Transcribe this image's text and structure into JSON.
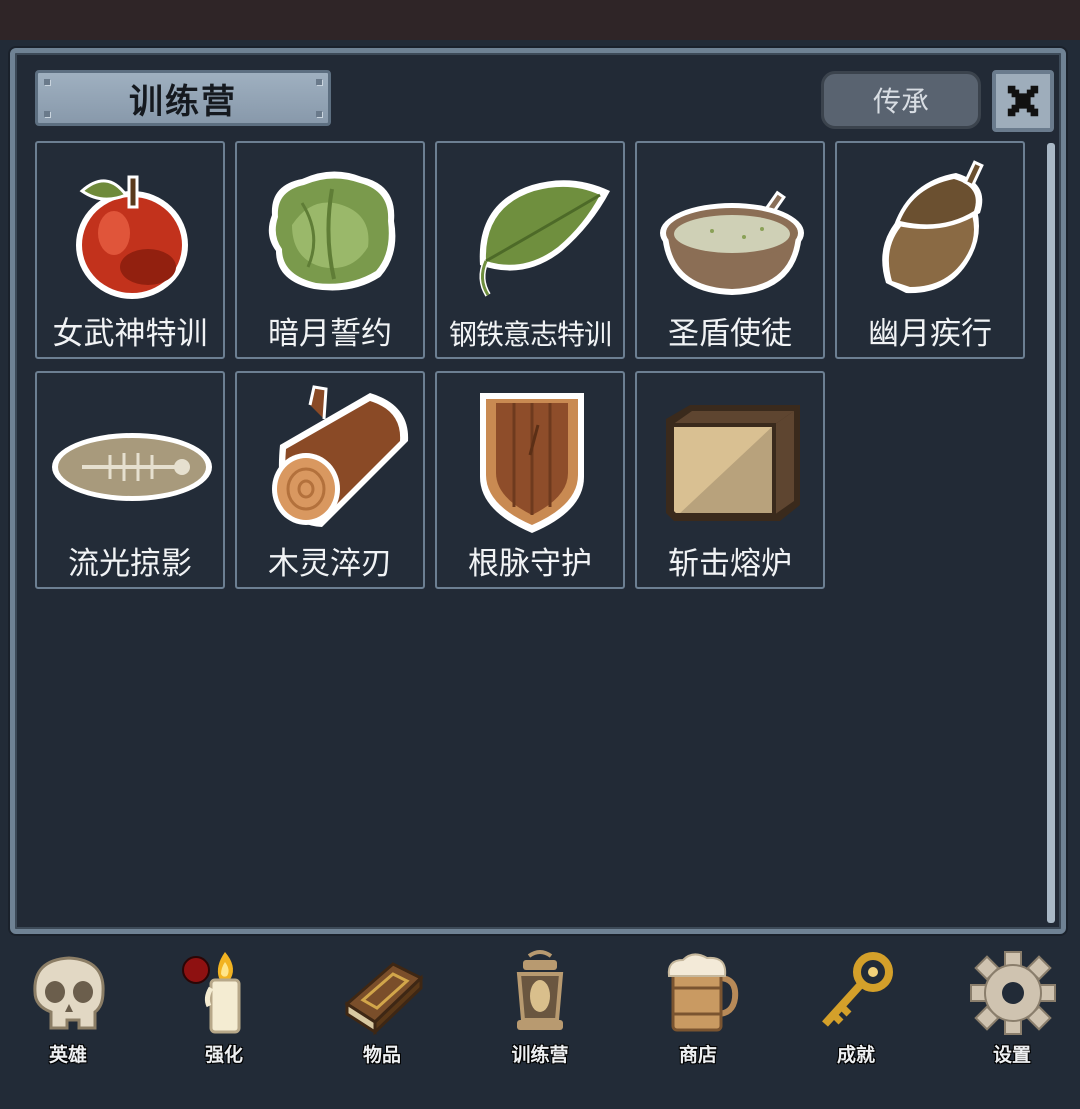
{
  "window": {
    "title": "训练营",
    "inherit_label": "传承",
    "close_icon": "close-icon"
  },
  "items": [
    {
      "label": "女武神特训",
      "icon": "apple-icon"
    },
    {
      "label": "暗月誓约",
      "icon": "cabbage-icon"
    },
    {
      "label": "钢铁意志特训",
      "icon": "leaf-icon"
    },
    {
      "label": "圣盾使徒",
      "icon": "bowl-icon"
    },
    {
      "label": "幽月疾行",
      "icon": "acorn-icon"
    },
    {
      "label": "流光掠影",
      "icon": "fish-bone-icon"
    },
    {
      "label": "木灵淬刃",
      "icon": "log-icon"
    },
    {
      "label": "根脉守护",
      "icon": "wooden-shield-icon"
    },
    {
      "label": "斩击熔炉",
      "icon": "crate-icon"
    }
  ],
  "nav": [
    {
      "label": "英雄",
      "icon": "skull-icon"
    },
    {
      "label": "强化",
      "icon": "candle-icon",
      "badge": true
    },
    {
      "label": "物品",
      "icon": "book-icon"
    },
    {
      "label": "训练营",
      "icon": "lantern-icon"
    },
    {
      "label": "商店",
      "icon": "beer-mug-icon"
    },
    {
      "label": "成就",
      "icon": "key-icon"
    },
    {
      "label": "设置",
      "icon": "gear-icon"
    }
  ],
  "colors": {
    "background": "#222b37",
    "panel_border": "#6f8294",
    "title_plate": "#9fb0c0",
    "badge": "#8e1111"
  }
}
